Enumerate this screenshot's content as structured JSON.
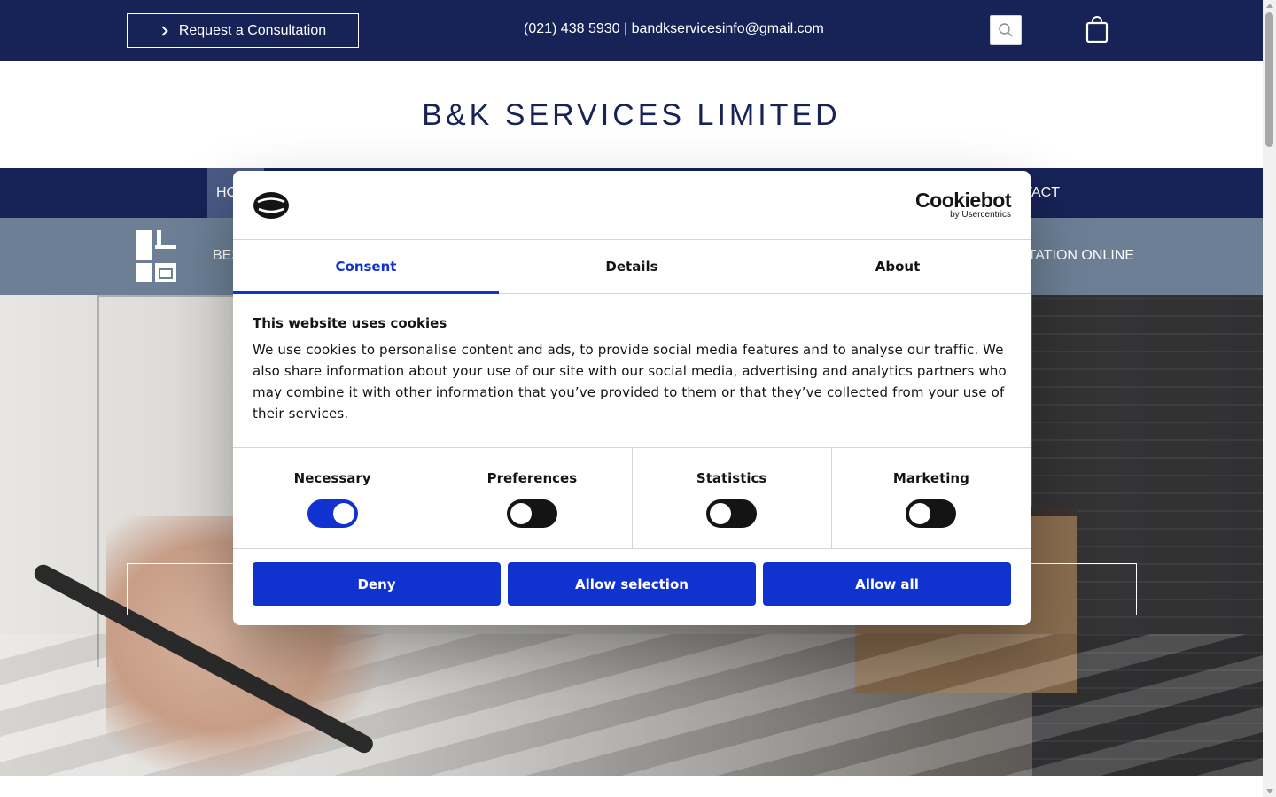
{
  "topbar": {
    "consult_label": "Request a Consultation",
    "contact_text": "(021) 438 5930 | bandkservicesinfo@gmail.com",
    "search_icon": "search-icon",
    "cart_icon": "shopping-bag-icon"
  },
  "brand": {
    "title": "B&K SERVICES LIMITED"
  },
  "nav": {
    "home_label": "HOME",
    "contact_label": "CONTACT"
  },
  "subbar": {
    "left_text": "BES",
    "right_text": "CONSULTATION ONLINE"
  },
  "dialog": {
    "brand_name": "Cookiebot",
    "brand_sub": "by Usercentrics",
    "tabs": [
      {
        "label": "Consent",
        "active": true
      },
      {
        "label": "Details",
        "active": false
      },
      {
        "label": "About",
        "active": false
      }
    ],
    "heading": "This website uses cookies",
    "body": "We use cookies to personalise content and ads, to provide social media features and to analyse our traffic. We also share information about your use of our site with our social media, advertising and analytics partners who may combine it with other information that you’ve provided to them or that they’ve collected from your use of their services.",
    "categories": [
      {
        "label": "Necessary",
        "enabled": true
      },
      {
        "label": "Preferences",
        "enabled": false
      },
      {
        "label": "Statistics",
        "enabled": false
      },
      {
        "label": "Marketing",
        "enabled": false
      }
    ],
    "buttons": {
      "deny": "Deny",
      "allow_selection": "Allow selection",
      "allow_all": "Allow all"
    }
  },
  "colors": {
    "navy": "#172257",
    "slate": "#6c7f95",
    "cookiebot_blue": "#1032cf"
  }
}
